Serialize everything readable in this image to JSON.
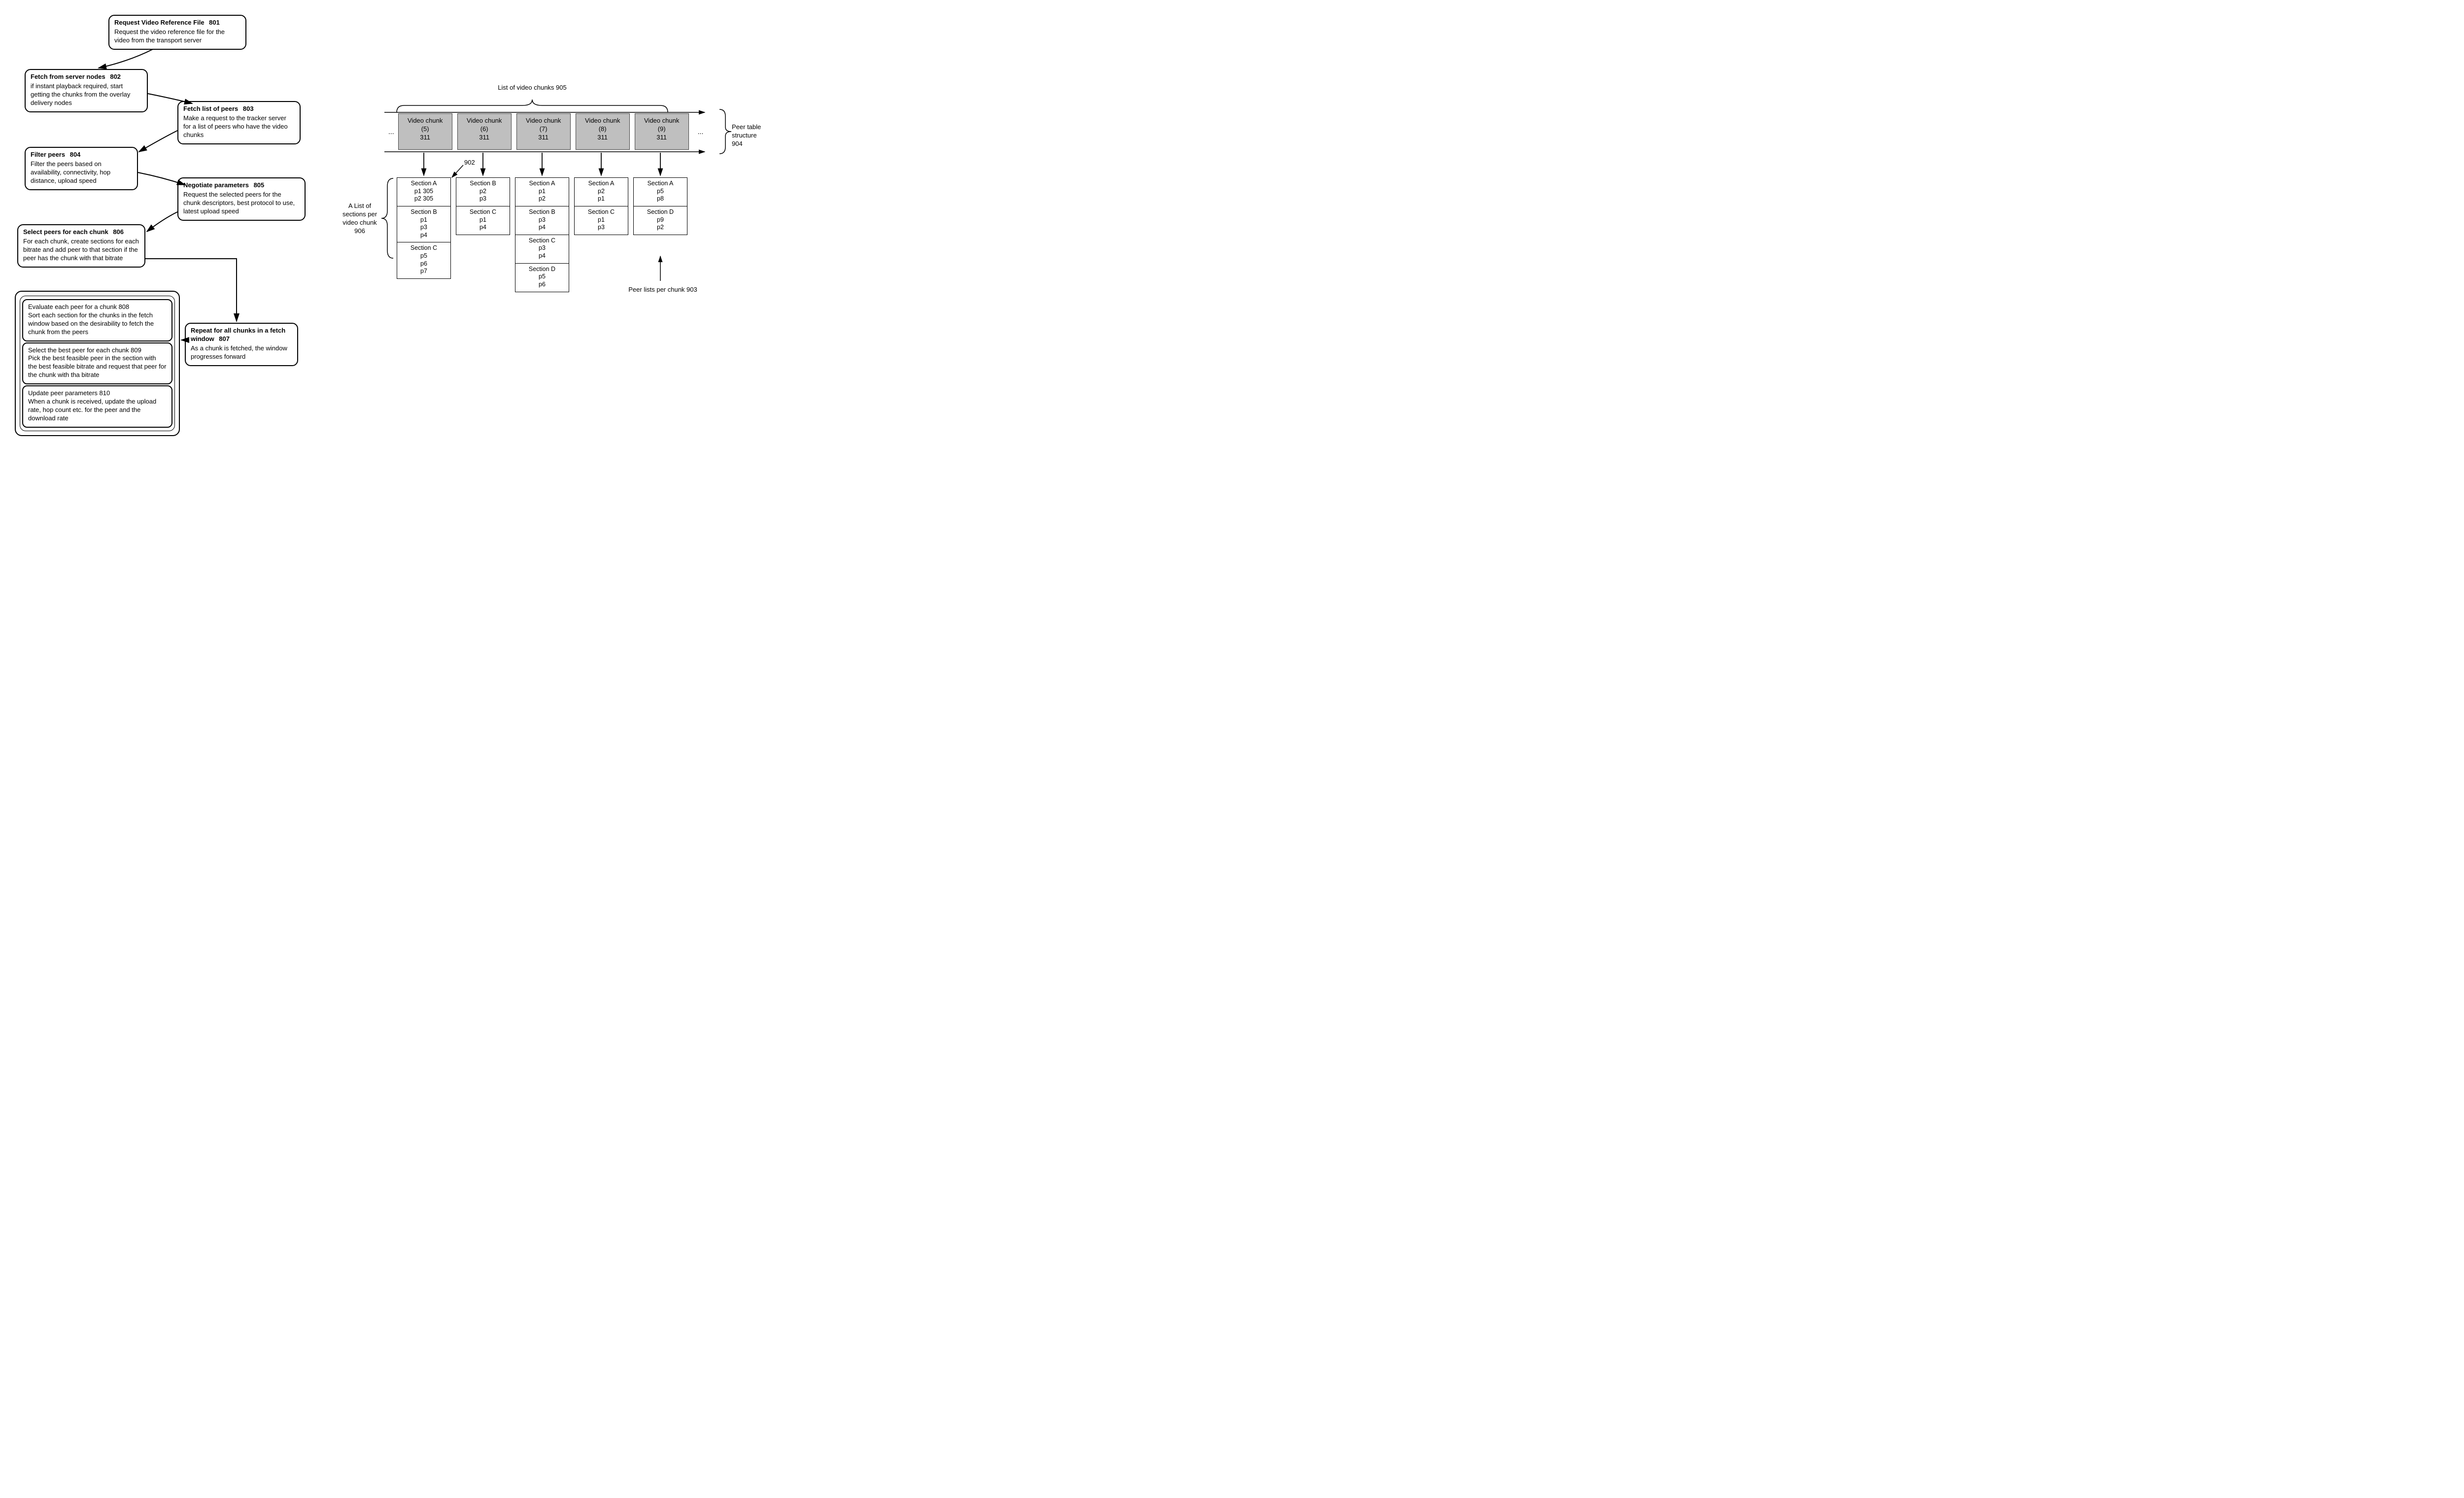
{
  "flow": {
    "b801": {
      "title": "Request Video Reference File",
      "ref": "801",
      "body": "Request the video reference file for the video from the transport server"
    },
    "b802": {
      "title": "Fetch from server nodes",
      "ref": "802",
      "body": "if instant playback required, start getting the chunks from the overlay delivery nodes"
    },
    "b803": {
      "title": "Fetch list of peers",
      "ref": "803",
      "body": "Make a request to the tracker server for a list of peers who have the video chunks"
    },
    "b804": {
      "title": "Filter peers",
      "ref": "804",
      "body": "Filter the peers based on availability, connectivity, hop distance, upload speed"
    },
    "b805": {
      "title": "Negotiate parameters",
      "ref": "805",
      "body": "Request the selected peers for the chunk descriptors, best protocol to use, latest upload speed"
    },
    "b806": {
      "title": "Select peers for each chunk",
      "ref": "806",
      "body": "For each chunk, create sections for each bitrate and add peer to that section if the peer has the chunk with that bitrate"
    },
    "b807": {
      "title": "Repeat for all chunks in a fetch window",
      "ref": "807",
      "body": "As a chunk is fetched, the window progresses forward"
    },
    "b808": {
      "title": "Evaluate each peer for a chunk",
      "ref": "808",
      "body": "Sort each section for the chunks in the fetch window based on the desirability to fetch the chunk from the peers"
    },
    "b809": {
      "title": "Select the best peer for each chunk",
      "ref": "809",
      "body": "Pick the best feasible peer in the section with the best feasible bitrate and request that peer for the chunk with tha bitrate"
    },
    "b810": {
      "title": "Update peer parameters",
      "ref": "810",
      "body": "When a chunk is received, update the upload rate, hop count etc. for the peer and the download rate"
    }
  },
  "peer": {
    "list_of_chunks_label": "List of video chunks 905",
    "structure_label": "Peer table structure 904",
    "sections_label": "A List of sections per video chunk 906",
    "peer_lists_label": "Peer lists per chunk 903",
    "callout_902": "902",
    "ellipsis": "...",
    "chunks": [
      {
        "name": "Video chunk",
        "idx": "(5)",
        "ref": "311"
      },
      {
        "name": "Video chunk",
        "idx": "(6)",
        "ref": "311"
      },
      {
        "name": "Video chunk",
        "idx": "(7)",
        "ref": "311"
      },
      {
        "name": "Video chunk",
        "idx": "(8)",
        "ref": "311"
      },
      {
        "name": "Video chunk",
        "idx": "(9)",
        "ref": "311"
      }
    ],
    "columns": [
      {
        "sections": [
          {
            "name": "Section A",
            "peers": [
              "p1 305",
              "p2 305"
            ]
          },
          {
            "name": "Section B",
            "peers": [
              "p1",
              "p3",
              "p4"
            ]
          },
          {
            "name": "Section C",
            "peers": [
              "p5",
              "p6",
              "p7"
            ]
          }
        ]
      },
      {
        "sections": [
          {
            "name": "Section B",
            "peers": [
              "p2",
              "p3"
            ]
          },
          {
            "name": "Section C",
            "peers": [
              "p1",
              "p4"
            ]
          }
        ]
      },
      {
        "sections": [
          {
            "name": "Section A",
            "peers": [
              "p1",
              "p2"
            ]
          },
          {
            "name": "Section B",
            "peers": [
              "p3",
              "p4"
            ]
          },
          {
            "name": "Section C",
            "peers": [
              "p3",
              "p4"
            ]
          },
          {
            "name": "Section D",
            "peers": [
              "p5",
              "p6"
            ]
          }
        ]
      },
      {
        "sections": [
          {
            "name": "Section A",
            "peers": [
              "p2",
              "p1"
            ]
          },
          {
            "name": "Section C",
            "peers": [
              "p1",
              "p3"
            ]
          }
        ]
      },
      {
        "sections": [
          {
            "name": "Section A",
            "peers": [
              "p5",
              "p8"
            ]
          },
          {
            "name": "Section D",
            "peers": [
              "p9",
              "p2"
            ]
          }
        ]
      }
    ]
  }
}
